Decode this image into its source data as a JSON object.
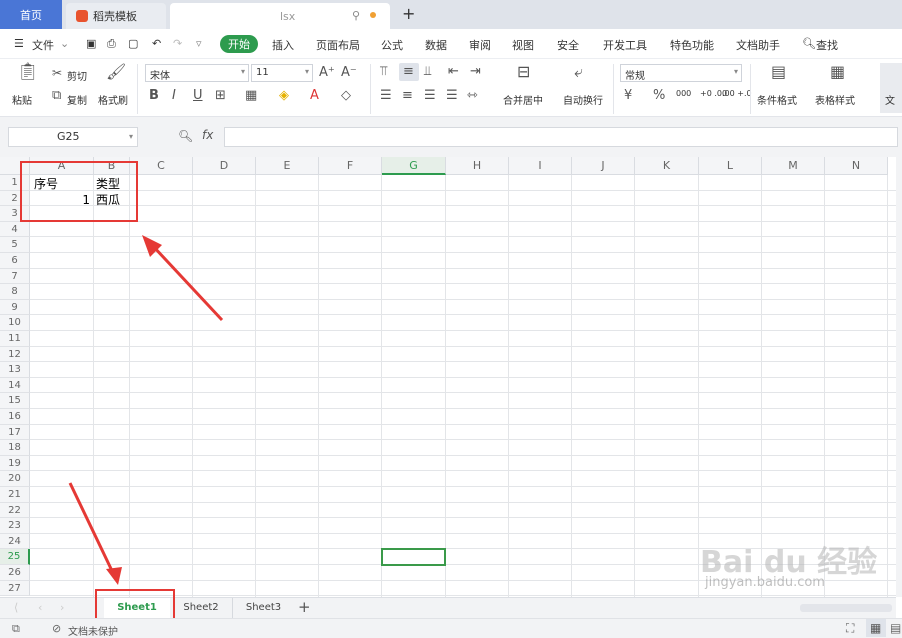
{
  "tabs": {
    "home": "首页",
    "template": "稻壳模板",
    "doc": "lsx",
    "plus": "+"
  },
  "menu": {
    "file": "文件",
    "start": "开始",
    "items": [
      "插入",
      "页面布局",
      "公式",
      "数据",
      "审阅",
      "视图",
      "安全",
      "开发工具",
      "特色功能",
      "文档助手"
    ],
    "search": "查找"
  },
  "ribbon": {
    "paste": "粘贴",
    "cut": "剪切",
    "copy": "复制",
    "format_painter": "格式刷",
    "font": "宋体",
    "font_size": "11",
    "number_format": "常规",
    "merge": "合并居中",
    "wrap": "自动换行",
    "cond_format": "条件格式",
    "table_style": "表格样式",
    "more": "文",
    "percent": "%",
    "thousands": "000",
    "inc_dec": "+0 .00",
    "dec_dec": ".00 +.0"
  },
  "formula": {
    "cell_ref": "G25",
    "fx": "fx"
  },
  "columns": [
    "A",
    "B",
    "C",
    "D",
    "E",
    "F",
    "G",
    "H",
    "I",
    "J",
    "K",
    "L",
    "M",
    "N"
  ],
  "rows": [
    "1",
    "2",
    "3",
    "4",
    "5",
    "6",
    "7",
    "8",
    "9",
    "10",
    "11",
    "12",
    "13",
    "14",
    "15",
    "16",
    "17",
    "18",
    "19",
    "20",
    "21",
    "22",
    "23",
    "24",
    "25",
    "26",
    "27"
  ],
  "cells": {
    "A1": "序号",
    "B1": "类型",
    "A2": "1",
    "B2": "西瓜"
  },
  "sheets": [
    "Sheet1",
    "Sheet2",
    "Sheet3"
  ],
  "status": {
    "protect": "文档未保护"
  },
  "watermark": {
    "brand": "Bai du 经验",
    "url": "jingyan.baidu.com"
  },
  "colors": {
    "accent_green": "#2d9b4e",
    "tab_blue": "#4a76d6",
    "annotation_red": "#e53935"
  }
}
